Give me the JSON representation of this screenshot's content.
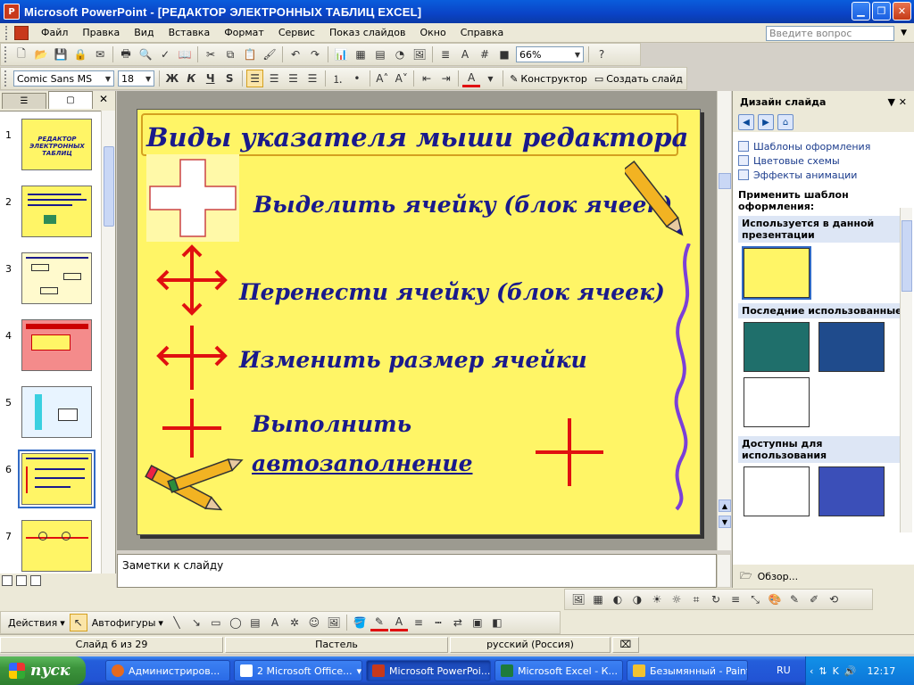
{
  "window": {
    "title": "Microsoft PowerPoint - [РЕДАКТОР ЭЛЕКТРОННЫХ ТАБЛИЦ EXCEL]"
  },
  "menu": {
    "items": [
      "Файл",
      "Правка",
      "Вид",
      "Вставка",
      "Формат",
      "Сервис",
      "Показ слайдов",
      "Окно",
      "Справка"
    ],
    "ask_placeholder": "Введите вопрос"
  },
  "standard_toolbar": {
    "zoom": "66%"
  },
  "format_toolbar": {
    "font": "Comic Sans MS",
    "size": "18",
    "bold": "Ж",
    "italic": "К",
    "underline": "Ч",
    "shadow": "S",
    "designer": "Конструктор",
    "new_slide": "Создать слайд"
  },
  "outline": {
    "slides": [
      {
        "num": "1",
        "title": "РЕДАКТОР ЭЛЕКТРОННЫХ ТАБЛИЦ"
      },
      {
        "num": "2",
        "title": ""
      },
      {
        "num": "3",
        "title": ""
      },
      {
        "num": "4",
        "title": ""
      },
      {
        "num": "5",
        "title": ""
      },
      {
        "num": "6",
        "title": ""
      },
      {
        "num": "7",
        "title": ""
      }
    ]
  },
  "slide": {
    "title": "Виды указателя мыши редактора",
    "items": [
      "Выделить ячейку (блок ячеек)",
      "Перенести ячейку (блок ячеек)",
      "Изменить размер ячейки",
      "Выполнить",
      "автозаполнение"
    ]
  },
  "notes": {
    "placeholder": "Заметки к слайду"
  },
  "task_pane": {
    "title": "Дизайн слайда",
    "links": [
      "Шаблоны оформления",
      "Цветовые схемы",
      "Эффекты анимации"
    ],
    "apply_label": "Применить шаблон оформления:",
    "sections": [
      "Используется в данной презентации",
      "Последние использованные",
      "Доступны для использования"
    ],
    "browse": "Обзор..."
  },
  "draw_toolbar": {
    "actions": "Действия",
    "autoshapes": "Автофигуры"
  },
  "status": {
    "slide_of": "Слайд 6 из 29",
    "design": "Пастель",
    "language": "русский (Россия)"
  },
  "taskbar": {
    "start": "пуск",
    "buttons": [
      "Администриров...",
      "2 Microsoft Office...",
      "Microsoft PowerPoi...",
      "Microsoft Excel - К...",
      "Безымянный - Paint"
    ],
    "lang": "RU",
    "time": "12:17"
  },
  "colors": {
    "slide_bg": "#fff566",
    "slide_text": "#1a1a8c",
    "cursor_red": "#e01010",
    "title_bar": "#0a43c6"
  }
}
